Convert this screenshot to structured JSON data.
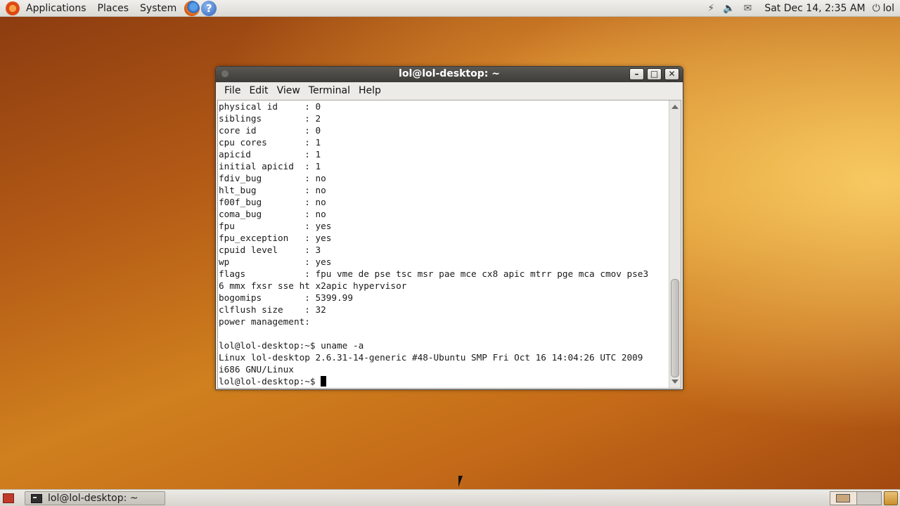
{
  "top_panel": {
    "menus": [
      "Applications",
      "Places",
      "System"
    ],
    "clock": "Sat Dec 14,  2:35 AM",
    "user": "lol"
  },
  "window": {
    "title": "lol@lol-desktop: ~",
    "menu": [
      "File",
      "Edit",
      "View",
      "Terminal",
      "Help"
    ],
    "terminal_lines": [
      "physical id     : 0",
      "siblings        : 2",
      "core id         : 0",
      "cpu cores       : 1",
      "apicid          : 1",
      "initial apicid  : 1",
      "fdiv_bug        : no",
      "hlt_bug         : no",
      "f00f_bug        : no",
      "coma_bug        : no",
      "fpu             : yes",
      "fpu_exception   : yes",
      "cpuid level     : 3",
      "wp              : yes",
      "flags           : fpu vme de pse tsc msr pae mce cx8 apic mtrr pge mca cmov pse3",
      "6 mmx fxsr sse ht x2apic hypervisor",
      "bogomips        : 5399.99",
      "clflush size    : 32",
      "power management:",
      "",
      "lol@lol-desktop:~$ uname -a",
      "Linux lol-desktop 2.6.31-14-generic #48-Ubuntu SMP Fri Oct 16 14:04:26 UTC 2009",
      "i686 GNU/Linux"
    ],
    "prompt": "lol@lol-desktop:~$ "
  },
  "bottom_panel": {
    "task_label": "lol@lol-desktop: ~"
  }
}
